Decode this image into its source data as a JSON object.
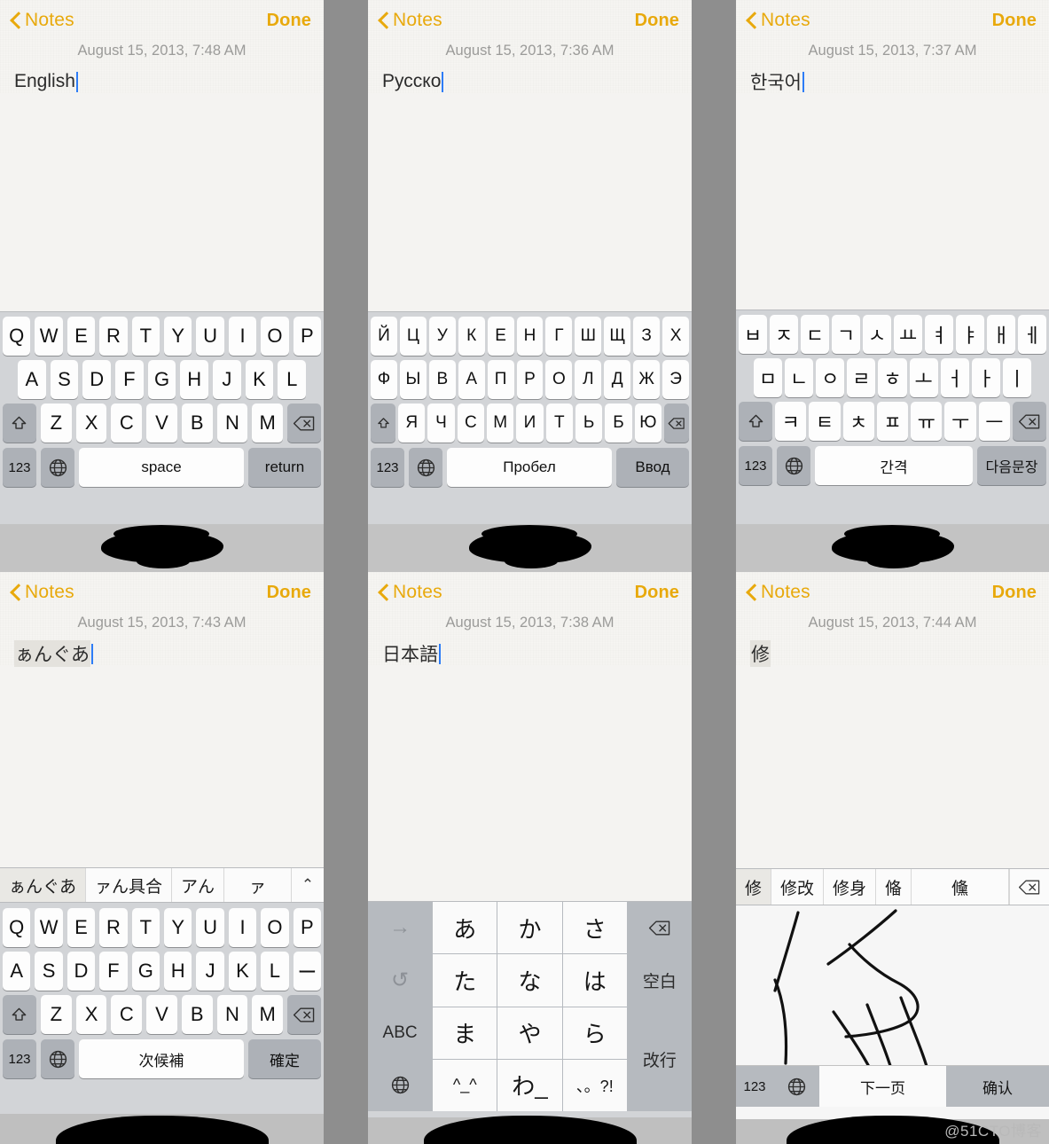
{
  "common": {
    "back_label": "Notes",
    "done_label": "Done",
    "key_123": "123",
    "icon_back": "chevron-left-icon",
    "icon_globe": "globe-icon",
    "icon_shift": "shift-icon",
    "icon_backspace": "backspace-icon",
    "accent_color": "#e8a90c",
    "caret_color": "#2d7cf6"
  },
  "watermark": "@51CTO博客",
  "panels": [
    {
      "id": "english",
      "date": "August 15, 2013, 7:48 AM",
      "text": "English",
      "text_marked": false,
      "keyboard": {
        "type": "qwerty",
        "rows": [
          [
            "Q",
            "W",
            "E",
            "R",
            "T",
            "Y",
            "U",
            "I",
            "O",
            "P"
          ],
          [
            "A",
            "S",
            "D",
            "F",
            "G",
            "H",
            "J",
            "K",
            "L"
          ],
          [
            "Z",
            "X",
            "C",
            "V",
            "B",
            "N",
            "M"
          ]
        ],
        "space_label": "space",
        "return_label": "return"
      }
    },
    {
      "id": "russian",
      "date": "August 15, 2013, 7:36 AM",
      "text": "Русско",
      "text_marked": false,
      "keyboard": {
        "type": "qwerty",
        "rows": [
          [
            "Й",
            "Ц",
            "У",
            "К",
            "Е",
            "Н",
            "Г",
            "Ш",
            "Щ",
            "З",
            "Х"
          ],
          [
            "Ф",
            "Ы",
            "В",
            "А",
            "П",
            "Р",
            "О",
            "Л",
            "Д",
            "Ж",
            "Э"
          ],
          [
            "Я",
            "Ч",
            "С",
            "М",
            "И",
            "Т",
            "Ь",
            "Б",
            "Ю"
          ]
        ],
        "space_label": "Пробел",
        "return_label": "Ввод"
      }
    },
    {
      "id": "korean",
      "date": "August 15, 2013, 7:37 AM",
      "text": "한국어",
      "text_marked": false,
      "keyboard": {
        "type": "qwerty",
        "rows": [
          [
            "ㅂ",
            "ㅈ",
            "ㄷ",
            "ㄱ",
            "ㅅ",
            "ㅛ",
            "ㅕ",
            "ㅑ",
            "ㅐ",
            "ㅔ"
          ],
          [
            "ㅁ",
            "ㄴ",
            "ㅇ",
            "ㄹ",
            "ㅎ",
            "ㅗ",
            "ㅓ",
            "ㅏ",
            "ㅣ"
          ],
          [
            "ㅋ",
            "ㅌ",
            "ㅊ",
            "ㅍ",
            "ㅠ",
            "ㅜ",
            "ㅡ"
          ]
        ],
        "space_label": "간격",
        "return_label": "다음문장"
      }
    },
    {
      "id": "japanese-romaji",
      "date": "August 15, 2013, 7:43 AM",
      "text": "ぁんぐあ",
      "text_marked": true,
      "candidates": [
        "ぁんぐあ",
        "ァん具合",
        "アん",
        "ァ"
      ],
      "candidate_expand": "⌃",
      "keyboard": {
        "type": "qwerty",
        "rows": [
          [
            "Q",
            "W",
            "E",
            "R",
            "T",
            "Y",
            "U",
            "I",
            "O",
            "P"
          ],
          [
            "A",
            "S",
            "D",
            "F",
            "G",
            "H",
            "J",
            "K",
            "L",
            "ー"
          ],
          [
            "Z",
            "X",
            "C",
            "V",
            "B",
            "N",
            "M"
          ]
        ],
        "space_label": "次候補",
        "return_label": "確定"
      }
    },
    {
      "id": "japanese-kana",
      "date": "August 15, 2013, 7:38 AM",
      "text": "日本語",
      "text_marked": false,
      "keyboard": {
        "type": "kana12",
        "keys": [
          [
            "→",
            "あ",
            "か",
            "さ",
            "⌫"
          ],
          [
            "↺",
            "た",
            "な",
            "は",
            "空白"
          ],
          [
            "ABC",
            "ま",
            "や",
            "ら",
            "改行"
          ],
          [
            "globe",
            "^_^",
            "わ_",
            "、。?!",
            ""
          ]
        ]
      }
    },
    {
      "id": "chinese-handwriting",
      "date": "August 15, 2013, 7:44 AM",
      "text": "修",
      "text_marked": true,
      "candidates": [
        "修",
        "修改",
        "修身",
        "偹",
        "儵"
      ],
      "keyboard": {
        "type": "handwriting",
        "next_page_label": "下一页",
        "confirm_label": "确认"
      }
    }
  ]
}
